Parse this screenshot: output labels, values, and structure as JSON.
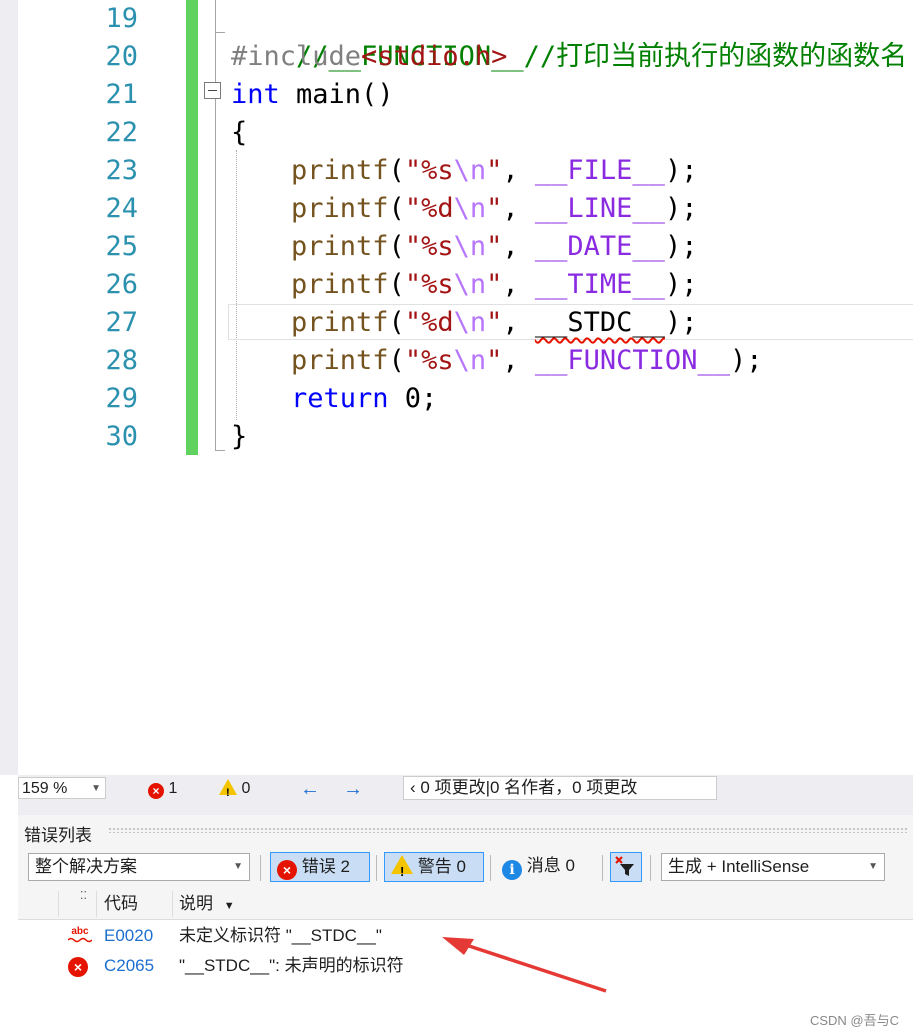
{
  "editor": {
    "line_numbers": [
      "19",
      "20",
      "21",
      "22",
      "23",
      "24",
      "25",
      "26",
      "27",
      "28",
      "29",
      "30"
    ],
    "lines": {
      "l19": {
        "comment": "//__FUNCTION__//打印当前执行的函数的函数名"
      },
      "l20": {
        "directive": "#include",
        "header": "<stdio.h>"
      },
      "l21": {
        "kw": "int",
        "rest": " main()"
      },
      "l22": {
        "text": "{"
      },
      "l23": {
        "fn": "printf",
        "open": "(",
        "q1": "\"",
        "fmt": "%s",
        "esc": "\\n",
        "q2": "\"",
        "comma": ", ",
        "macro": "__FILE__",
        "close": ");"
      },
      "l24": {
        "fn": "printf",
        "open": "(",
        "q1": "\"",
        "fmt": "%d",
        "esc": "\\n",
        "q2": "\"",
        "comma": ", ",
        "macro": "__LINE__",
        "close": ");"
      },
      "l25": {
        "fn": "printf",
        "open": "(",
        "q1": "\"",
        "fmt": "%s",
        "esc": "\\n",
        "q2": "\"",
        "comma": ", ",
        "macro": "__DATE__",
        "close": ");"
      },
      "l26": {
        "fn": "printf",
        "open": "(",
        "q1": "\"",
        "fmt": "%s",
        "esc": "\\n",
        "q2": "\"",
        "comma": ", ",
        "macro": "__TIME__",
        "close": ");"
      },
      "l27": {
        "fn": "printf",
        "open": "(",
        "q1": "\"",
        "fmt": "%d",
        "esc": "\\n",
        "q2": "\"",
        "comma": ", ",
        "macro": "__STDC__",
        "close": ");"
      },
      "l28": {
        "fn": "printf",
        "open": "(",
        "q1": "\"",
        "fmt": "%s",
        "esc": "\\n",
        "q2": "\"",
        "comma": ", ",
        "macro": "__FUNCTION__",
        "close": ");"
      },
      "l29": {
        "kw": "return",
        "rest": " 0;"
      },
      "l30": {
        "text": "}"
      }
    }
  },
  "status": {
    "zoom": "159 %",
    "error_count": "1",
    "warning_count": "0",
    "changes_text": "0 项更改|0 名作者，0 项更改"
  },
  "error_list": {
    "title": "错误列表",
    "scope": "整个解决方案",
    "errors_label": "错误 2",
    "warnings_label": "警告 0",
    "messages_label": "消息 0",
    "source": "生成 + IntelliSense",
    "columns": {
      "code": "代码",
      "description": "说明"
    },
    "rows": [
      {
        "icon": "abc",
        "code": "E0020",
        "description": "未定义标识符 \"__STDC__\""
      },
      {
        "icon": "error",
        "code": "C2065",
        "description": "\"__STDC__\": 未声明的标识符"
      }
    ]
  },
  "watermark": "CSDN @吾与C",
  "colors": {
    "accent": "#3399ff",
    "error": "#e51400",
    "warning": "#f5c400",
    "info": "#1e88e5",
    "change_bar": "#5fd25f"
  }
}
